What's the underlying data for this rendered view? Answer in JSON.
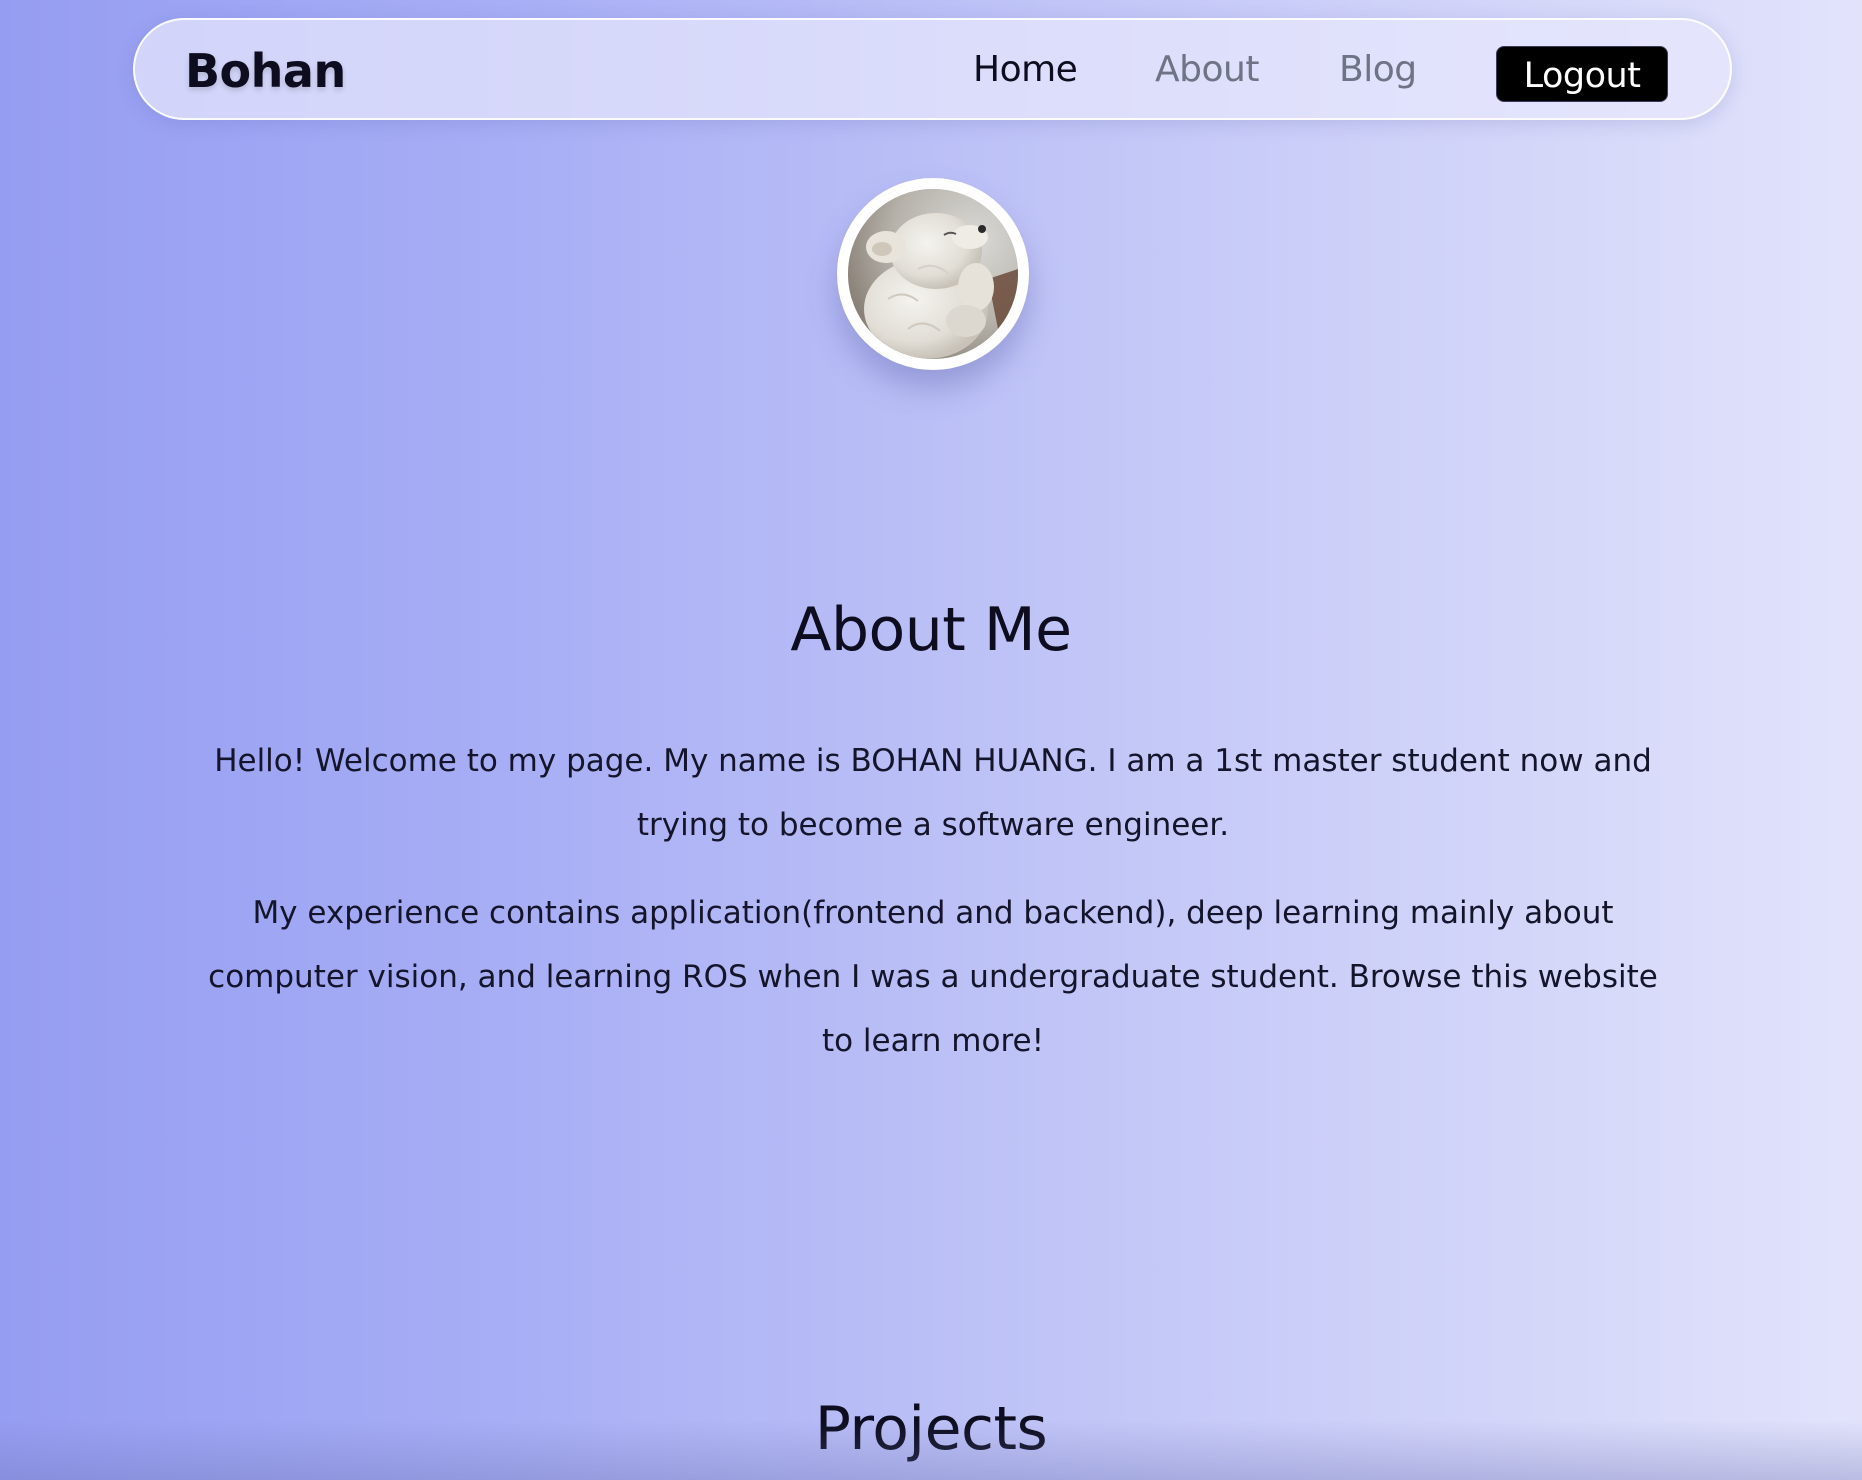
{
  "navbar": {
    "brand": "Bohan",
    "links": [
      {
        "label": "Home",
        "active": true
      },
      {
        "label": "About",
        "active": false
      },
      {
        "label": "Blog",
        "active": false
      }
    ],
    "logout_label": "Logout"
  },
  "avatar": {
    "alt": "profile photo of a white fluffy puppy"
  },
  "about": {
    "title": "About Me",
    "paragraphs": [
      "Hello! Welcome to my page. My name is BOHAN HUANG. I am a 1st master student now and trying to become a software engineer.",
      "My experience contains application(frontend and backend), deep learning mainly about computer vision, and learning ROS when I was a undergraduate student. Browse this website to learn more!"
    ]
  },
  "projects": {
    "title": "Projects"
  },
  "colors": {
    "gradient_start": "#959df2",
    "gradient_end": "#e2e3fb",
    "text_primary": "#0d0d1f",
    "nav_inactive": "#6e7385",
    "button_bg": "#000000",
    "button_text": "#ffffff"
  }
}
